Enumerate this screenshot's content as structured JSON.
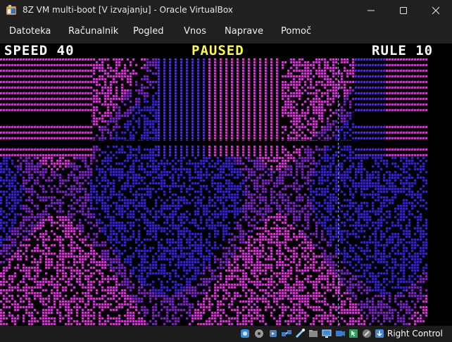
{
  "window": {
    "title": "8Z VM multi-boot [V izvajanju] - Oracle VirtualBox",
    "icon": "virtualbox-icon"
  },
  "menu": {
    "items": [
      "Datoteka",
      "Računalnik",
      "Pogled",
      "Vnos",
      "Naprave",
      "Pomoč"
    ]
  },
  "vm_display": {
    "speed_text": "SPEED 40",
    "paused_text": "PAUSED",
    "rule_text": "RULE 10",
    "colors": {
      "text": "#ffffff",
      "paused": "#ffff40",
      "background": "#000000",
      "magenta": "#ff30ff",
      "blue": "#4020ff",
      "violet": "#9020f0",
      "cursor_line": "#a0d8ff"
    }
  },
  "statusbar": {
    "host_key": "Right Control",
    "icons": [
      "hard-disk-icon",
      "optical-drive-icon",
      "audio-icon",
      "network-icon",
      "usb-icon",
      "shared-folders-icon",
      "display-icon",
      "video-capture-icon",
      "mouse-integration-icon",
      "keyboard-capture-icon"
    ]
  }
}
